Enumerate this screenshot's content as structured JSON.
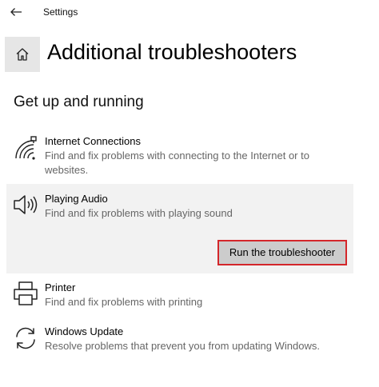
{
  "window": {
    "app_title": "Settings"
  },
  "header": {
    "page_title": "Additional troubleshooters"
  },
  "section": {
    "title": "Get up and running"
  },
  "items": [
    {
      "name": "Internet Connections",
      "description": "Find and fix problems with connecting to the Internet or to websites.",
      "icon": "wifi-network-icon"
    },
    {
      "name": "Playing Audio",
      "description": "Find and fix problems with playing sound",
      "icon": "speaker-icon",
      "selected": true,
      "action_label": "Run the troubleshooter"
    },
    {
      "name": "Printer",
      "description": "Find and fix problems with printing",
      "icon": "printer-icon"
    },
    {
      "name": "Windows Update",
      "description": "Resolve problems that prevent you from updating Windows.",
      "icon": "sync-icon"
    }
  ],
  "colors": {
    "selected_background": "#f2f2f2",
    "button_background": "#cccccc",
    "highlight_border": "#d4262a",
    "description_text": "#666666"
  }
}
